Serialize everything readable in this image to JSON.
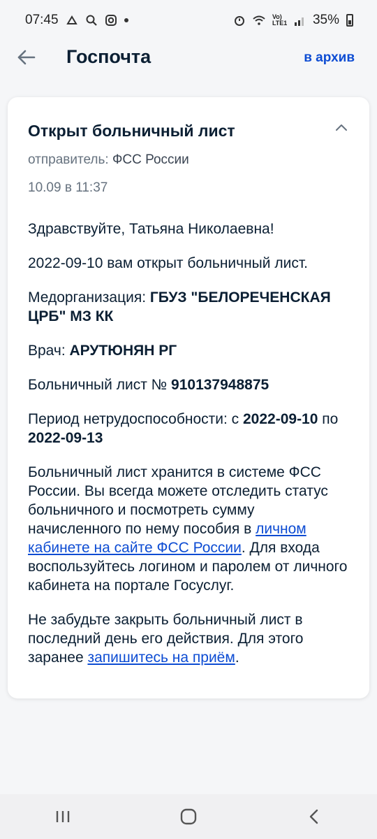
{
  "status_bar": {
    "time": "07:45",
    "battery": "35%",
    "network": "Vo) LTE1"
  },
  "header": {
    "title": "Госпочта",
    "archive_label": "в архив"
  },
  "message": {
    "title": "Открыт больничный лист",
    "sender_label": "отправитель:",
    "sender_value": "ФСС России",
    "date": "10.09 в 11:37",
    "greeting": "Здравствуйте, Татьяна Николаевна!",
    "opened_line": "2022-09-10 вам открыт больничный лист.",
    "medorg_label": "Медорганизация: ",
    "medorg_value": "ГБУЗ \"БЕЛОРЕЧЕНСКАЯ ЦРБ\" МЗ КК",
    "doctor_label": "Врач: ",
    "doctor_value": "АРУТЮНЯН РГ",
    "sheet_label": "Больничный лист № ",
    "sheet_number": "910137948875",
    "period_label": "Период нетрудоспособности: с ",
    "period_from": "2022-09-10",
    "period_mid": " по ",
    "period_to": "2022-09-13",
    "info_part1": "Больничный лист хранится в системе ФСС России. Вы всегда можете отследить статус больничного и посмотреть сумму начисленного по нему пособия в ",
    "info_link": "личном кабинете на сайте ФСС России",
    "info_part2": ". Для входа воспользуйтесь логином и паролем от личного кабинета на портале Госуслуг.",
    "reminder_part1": "Не забудьте закрыть больничный лист в последний день его действия. Для этого заранее ",
    "reminder_link": "запишитесь на приём",
    "reminder_part2": "."
  },
  "icons": {
    "back": "arrow-left-icon",
    "collapse": "chevron-up-icon",
    "nav_recent": "recent-apps-icon",
    "nav_home": "home-icon",
    "nav_back": "back-icon"
  },
  "colors": {
    "accent": "#0d4cd3",
    "text": "#0b1f33",
    "muted": "#66727f"
  }
}
